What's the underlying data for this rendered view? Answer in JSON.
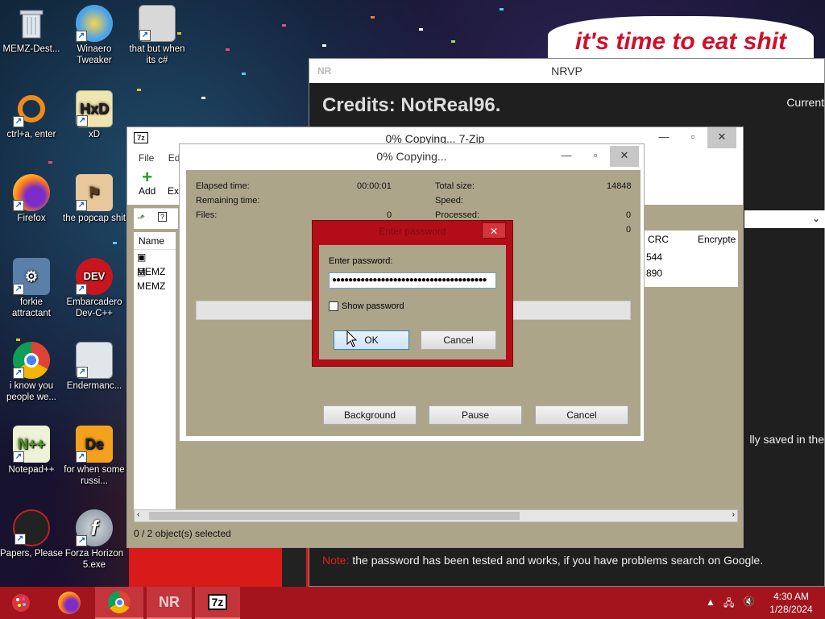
{
  "banner": {
    "text": "it's time to eat shit"
  },
  "desktop_icons": [
    {
      "label": "MEMZ-Dest...",
      "icon": "recycle-bin-icon"
    },
    {
      "label": "Winaero Tweaker",
      "icon": "winaero-icon"
    },
    {
      "label": "that but when its c#",
      "icon": "app-window-icon"
    },
    {
      "label": "ctrl+a, enter",
      "icon": "ring-icon"
    },
    {
      "label": "xD",
      "icon": "hxd-icon"
    },
    {
      "label": "Firefox",
      "icon": "firefox-icon"
    },
    {
      "label": "the popcap shit",
      "icon": "popcap-icon"
    },
    {
      "label": "forkie attractant",
      "icon": "settings-monitor-icon"
    },
    {
      "label": "Embarcadero Dev-C++",
      "icon": "devcpp-icon"
    },
    {
      "label": "i know you people we...",
      "icon": "chrome-icon"
    },
    {
      "label": "Endermanc...",
      "icon": "window-app-icon"
    },
    {
      "label": "Notepad++",
      "icon": "notepadpp-icon"
    },
    {
      "label": "for when some russi...",
      "icon": "de-icon"
    },
    {
      "label": "Papers, Please",
      "icon": "papers-please-icon"
    },
    {
      "label": "Forza Horizon 5.exe",
      "icon": "flash-icon"
    }
  ],
  "nrvp": {
    "badge": "NR",
    "title": "NRVP",
    "credits": "Credits: NotReal96.",
    "current": "Current",
    "saved": "lly saved in the",
    "note_label": "Note:",
    "note_text": "the password has been tested and works, if you have problems search on Google."
  },
  "zip": {
    "logo": "7z",
    "title": "0% Copying... 7-Zip",
    "menu": [
      "File",
      "Edit"
    ],
    "toolbar": {
      "add": "Add",
      "extract": "Ext"
    },
    "columns": {
      "name": "Name",
      "crc": "CRC",
      "encrypted": "Encrypte"
    },
    "rows": [
      {
        "name": "MEMZ",
        "crc": "544"
      },
      {
        "name": "MEMZ",
        "crc": "890"
      }
    ],
    "status": "0 / 2 object(s) selected"
  },
  "copy": {
    "title": "0% Copying...",
    "elapsed_label": "Elapsed time:",
    "elapsed_value": "00:00:01",
    "remaining_label": "Remaining time:",
    "files_label": "Files:",
    "files_value": "0",
    "total_label": "Total size:",
    "total_value": "14848",
    "speed_label": "Speed:",
    "processed_label": "Processed:",
    "processed_value": "0",
    "extra_value": "0",
    "buttons": {
      "background": "Background",
      "pause": "Pause",
      "cancel": "Cancel"
    }
  },
  "password": {
    "title": "Enter password",
    "prompt": "Enter password:",
    "value": "●●●●●●●●●●●●●●●●●●●●●●●●●●●●●●●●●●●●●●",
    "show_label": "Show password",
    "show_checked": false,
    "ok": "OK",
    "cancel": "Cancel"
  },
  "taskbar": {
    "apps": [
      "firefox-icon",
      "chrome-icon",
      "nr-icon",
      "7zip-icon"
    ],
    "nr_label": "NR",
    "zip_label": "7z",
    "time": "4:30 AM",
    "date": "1/28/2024"
  },
  "colors": {
    "taskbar": "#a3141d",
    "password_frame": "#b30e17",
    "dialog_body": "#ada58a",
    "banner_text": "#d0102a"
  }
}
